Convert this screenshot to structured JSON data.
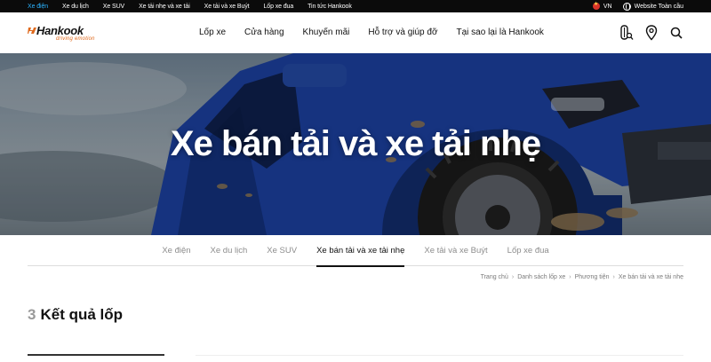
{
  "topbar": {
    "categories": [
      "Xe điện",
      "Xe du lịch",
      "Xe SUV",
      "Xe tải nhẹ và xe tải",
      "Xe tải và xe Buýt",
      "Lốp xe đua",
      "Tin tức Hankook"
    ],
    "language": "VN",
    "global_site": "Website Toàn cầu"
  },
  "header": {
    "logo_text": "Hankook",
    "logo_tagline": "driving emotion",
    "nav": [
      "Lốp xe",
      "Cửa hàng",
      "Khuyến mãi",
      "Hỗ trợ và giúp đỡ",
      "Tại sao lại là Hankook"
    ]
  },
  "hero": {
    "title": "Xe bán tải và xe tải nhẹ"
  },
  "tabs": {
    "items": [
      "Xe điện",
      "Xe du lịch",
      "Xe SUV",
      "Xe bán tải và xe tải nhẹ",
      "Xe tải và xe Buýt",
      "Lốp xe đua"
    ],
    "active_index": 3
  },
  "breadcrumb": {
    "items": [
      "Trang chủ",
      "Danh sách lốp xe",
      "Phương tiện",
      "Xe bán tải và xe tải nhẹ"
    ]
  },
  "results": {
    "count": "3",
    "label": "Kết quả lốp"
  },
  "colors": {
    "active_topbar": "#2bb3ff",
    "brand_orange": "#e06a1d",
    "truck_blue": "#1c3f9c"
  }
}
